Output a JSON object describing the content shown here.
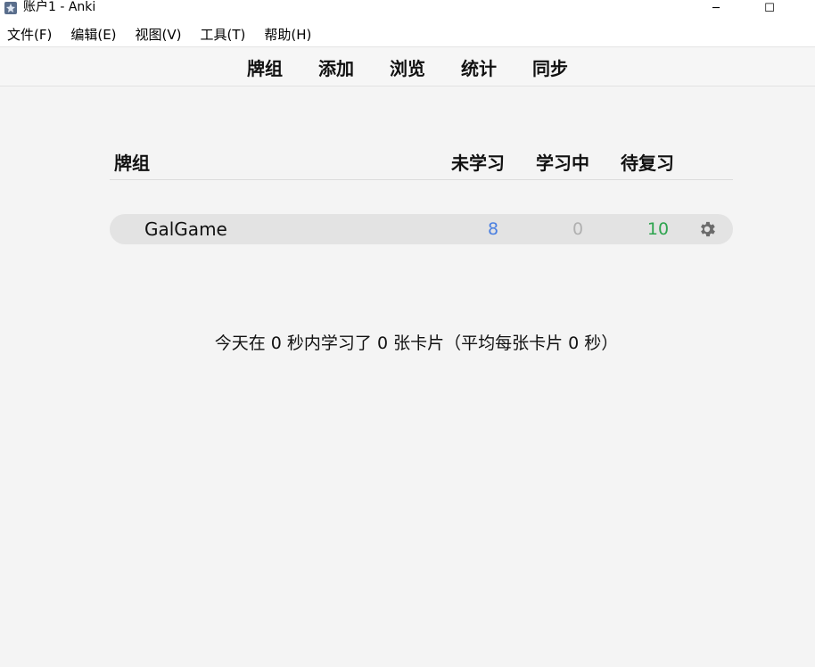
{
  "window": {
    "title": "账户1 - Anki",
    "icon": "anki-app-icon",
    "minimize_glyph": "─",
    "maximize_glyph": "☐"
  },
  "menubar": {
    "items": [
      {
        "label": "文件(F)"
      },
      {
        "label": "编辑(E)"
      },
      {
        "label": "视图(V)"
      },
      {
        "label": "工具(T)"
      },
      {
        "label": "帮助(H)"
      }
    ]
  },
  "toolbar": {
    "items": [
      {
        "label": "牌组"
      },
      {
        "label": "添加"
      },
      {
        "label": "浏览"
      },
      {
        "label": "统计"
      },
      {
        "label": "同步"
      }
    ]
  },
  "deck_table": {
    "headers": {
      "deck": "牌组",
      "new": "未学习",
      "learning": "学习中",
      "due": "待复习"
    },
    "rows": [
      {
        "name": "GalGame",
        "new": "8",
        "learning": "0",
        "due": "10",
        "options_icon": "gear-icon"
      }
    ]
  },
  "stats_text": "今天在 0 秒内学习了 0 张卡片（平均每张卡片 0 秒）",
  "colors": {
    "new": "#4a7fe0",
    "learning": "#b0b0b0",
    "due": "#2ea44f",
    "background": "#f4f4f4"
  }
}
